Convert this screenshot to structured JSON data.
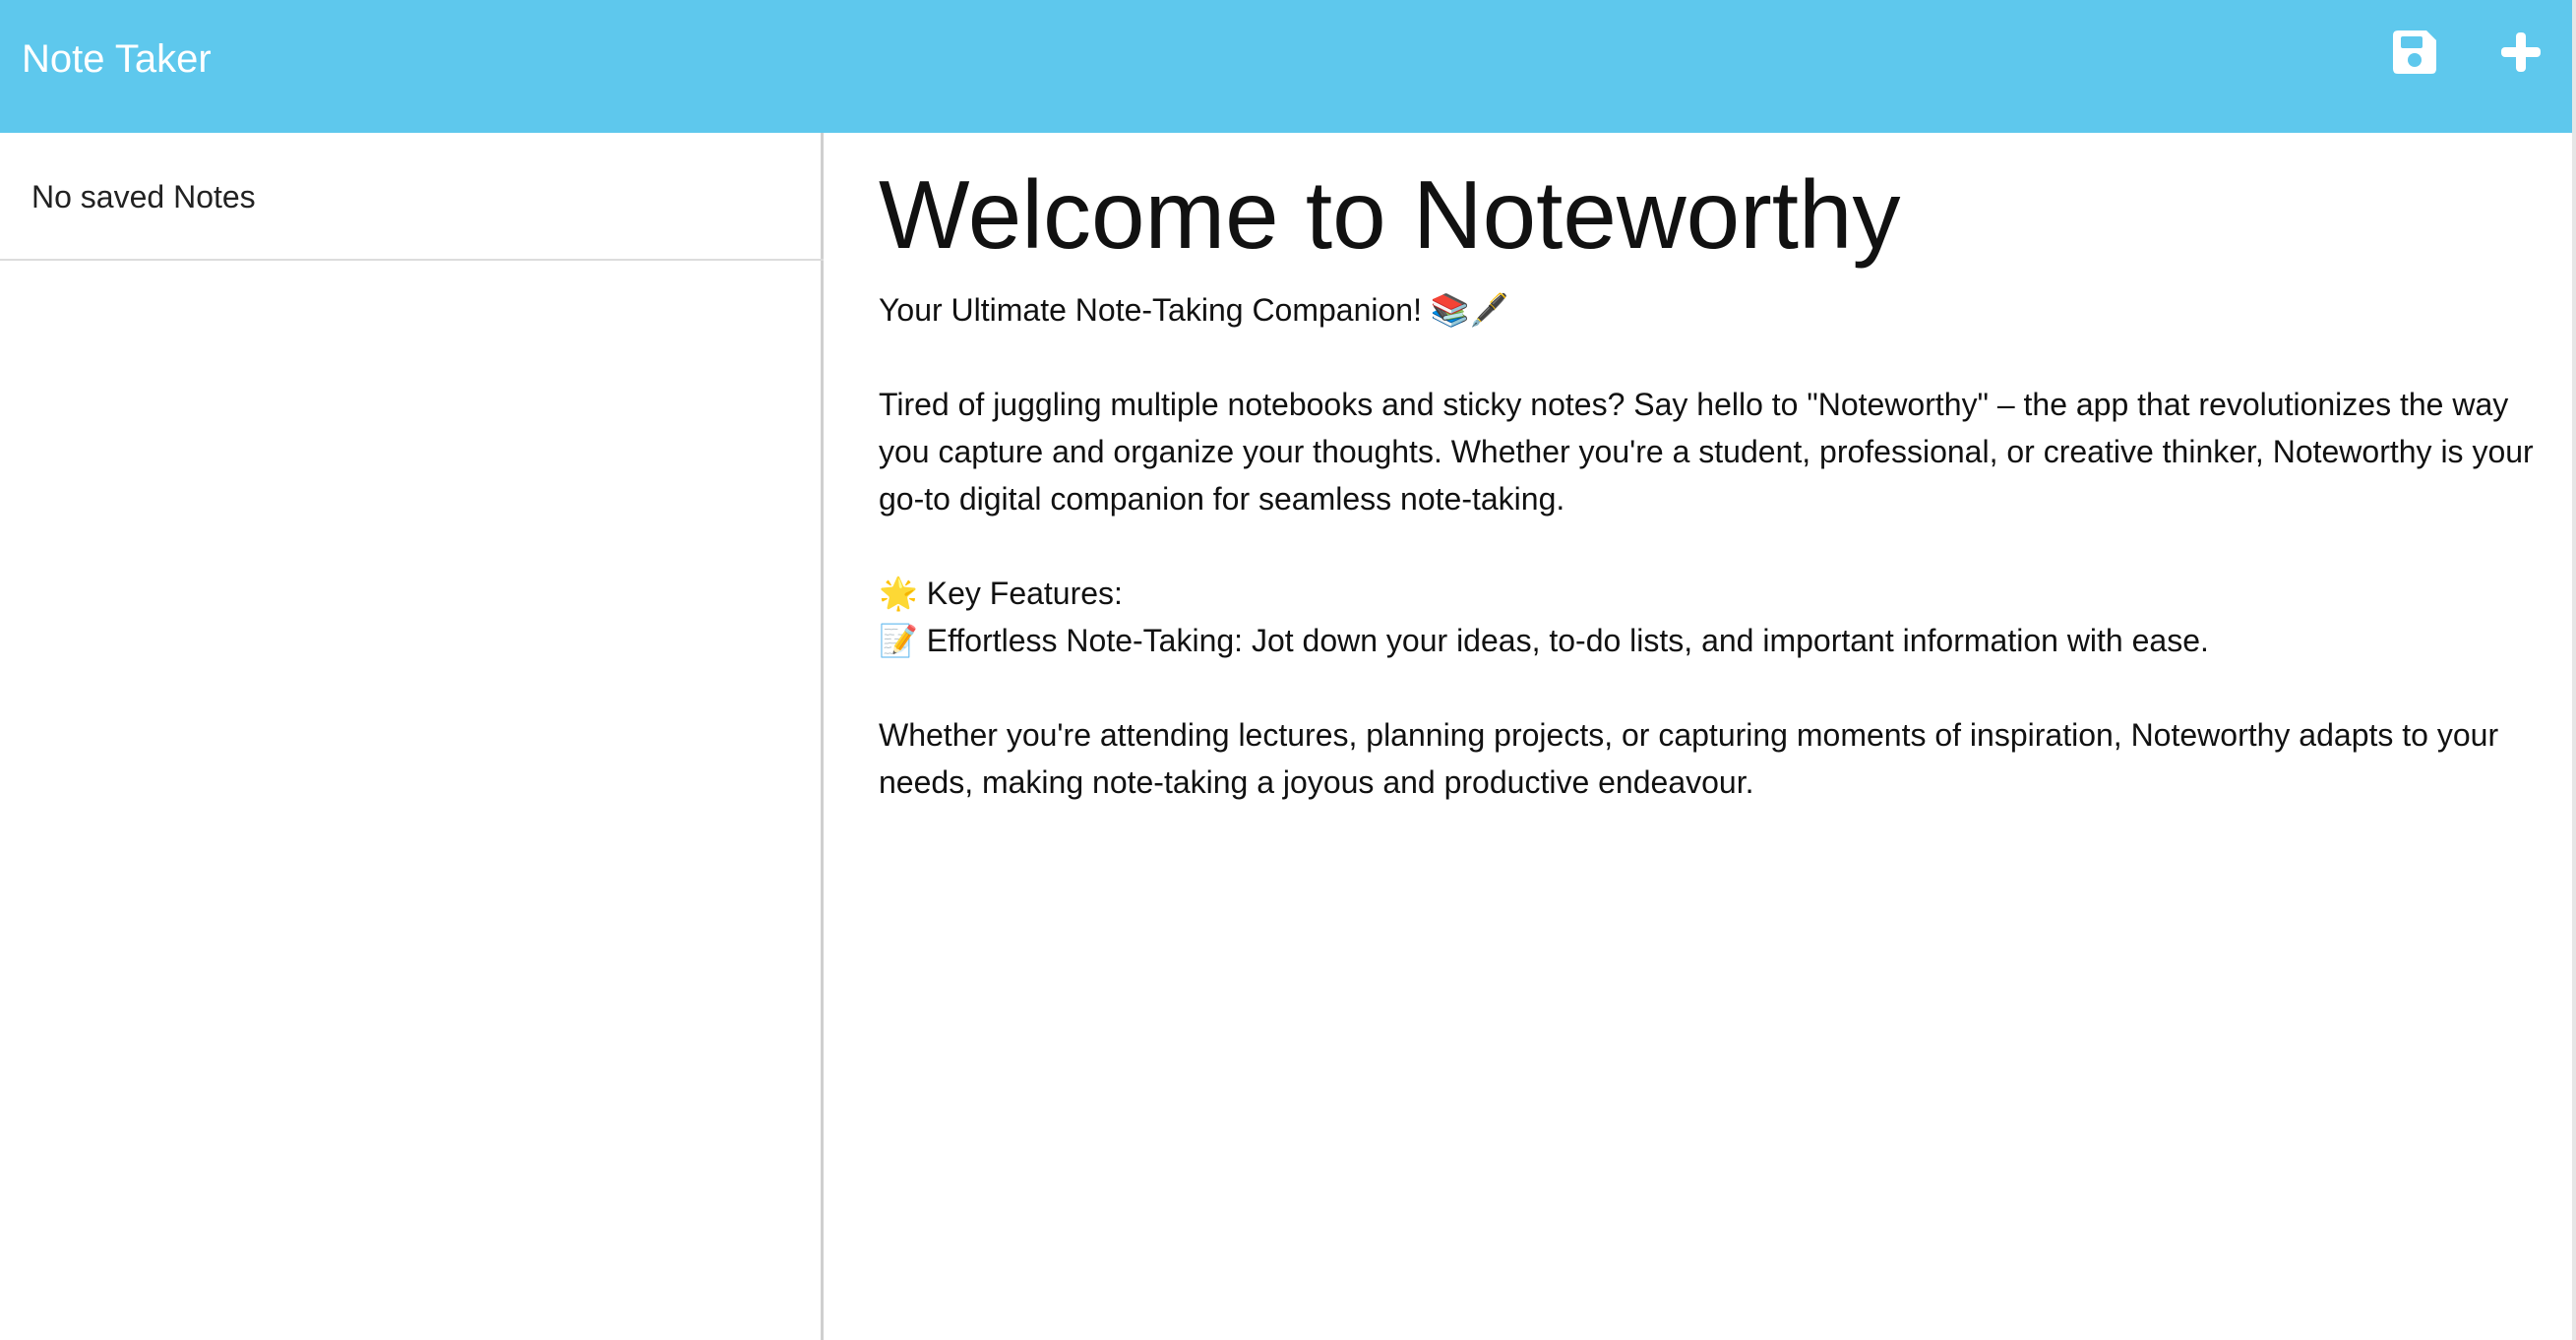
{
  "navbar": {
    "brand": "Note Taker",
    "save_icon": "save-icon",
    "new_note_icon": "plus-icon",
    "background": "#5ec8ed"
  },
  "sidebar": {
    "empty_message": "No saved Notes"
  },
  "note": {
    "title": "Welcome to Noteworthy",
    "lines": [
      "Your Ultimate Note-Taking Companion! 📚🖋️",
      "",
      "Tired of juggling multiple notebooks and sticky notes? Say hello to \"Noteworthy\" – the app that revolutionizes the way you capture and organize your thoughts. Whether you're a student, professional, or creative thinker, Noteworthy is your go-to digital companion for seamless note-taking.",
      "",
      "🌟 Key Features:",
      "📝 Effortless Note-Taking: Jot down your ideas, to-do lists, and important information with ease.",
      "",
      "Whether you're attending lectures, planning projects, or capturing moments of inspiration, Noteworthy adapts to your needs, making note-taking a joyous and productive endeavour."
    ]
  }
}
